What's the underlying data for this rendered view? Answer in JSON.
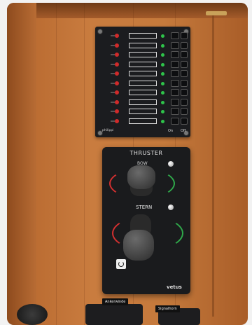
{
  "switch_panel": {
    "brand": "philippi",
    "on_label": "On",
    "off_label": "Off",
    "row_count": 10
  },
  "thruster_panel": {
    "title": "THRUSTER",
    "bow_label": "BOW",
    "stern_label": "STERN",
    "brand": "vetus"
  },
  "labels": {
    "left": "Ankerwinde",
    "right": "Signalhorn"
  },
  "colors": {
    "wood": "#c57a3c",
    "panel": "#1b1c1f",
    "led_green": "#2ec34a",
    "fuse_red": "#d02a2a",
    "arc_red": "#d43030",
    "arc_green": "#2fa84a"
  }
}
